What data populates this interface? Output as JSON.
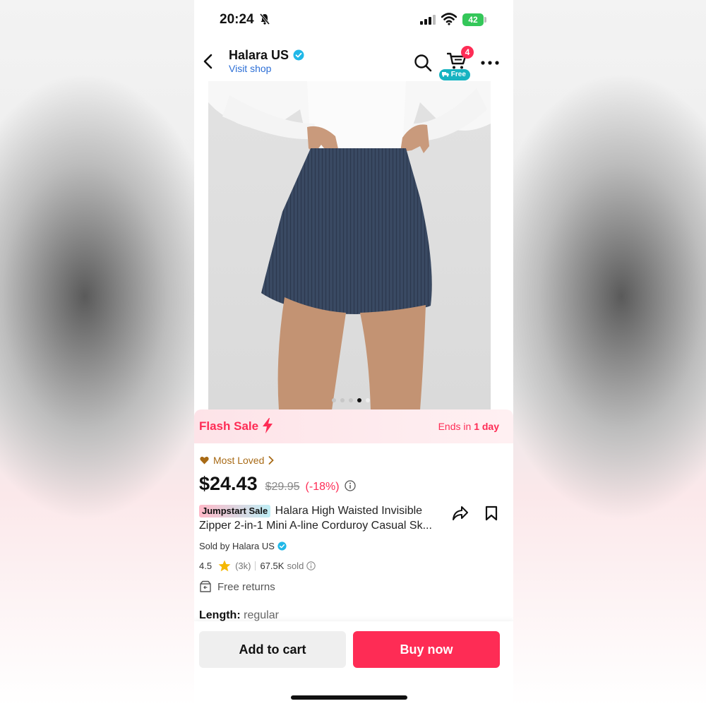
{
  "status_bar": {
    "time": "20:24",
    "battery": "42"
  },
  "header": {
    "shop_name": "Halara US",
    "visit_shop": "Visit shop",
    "cart_count": "4",
    "free_label": "Free"
  },
  "carousel": {
    "total": 5,
    "active_index": 3
  },
  "flash_sale": {
    "label": "Flash Sale",
    "ends_prefix": "Ends in",
    "ends_value": "1 day"
  },
  "product": {
    "most_loved": "Most Loved",
    "price": "$24.43",
    "original_price": "$29.95",
    "discount": "(-18%)",
    "badge": "Jumpstart Sale",
    "title_line1": "Halara High Waisted Invisible",
    "title_line2": "Zipper 2-in-1 Mini A-line Corduroy Casual Sk...",
    "sold_by": "Sold by Halara US",
    "rating": "4.5",
    "reviews": "(3k)",
    "sold": "67.5K",
    "sold_suffix": "sold",
    "returns": "Free returns",
    "length_label": "Length:",
    "length_value": "regular"
  },
  "actions": {
    "add_to_cart": "Add to cart",
    "buy_now": "Buy now"
  },
  "colors": {
    "accent": "#fe2c55",
    "verified": "#20b8e8",
    "most_loved": "#a86a15"
  }
}
